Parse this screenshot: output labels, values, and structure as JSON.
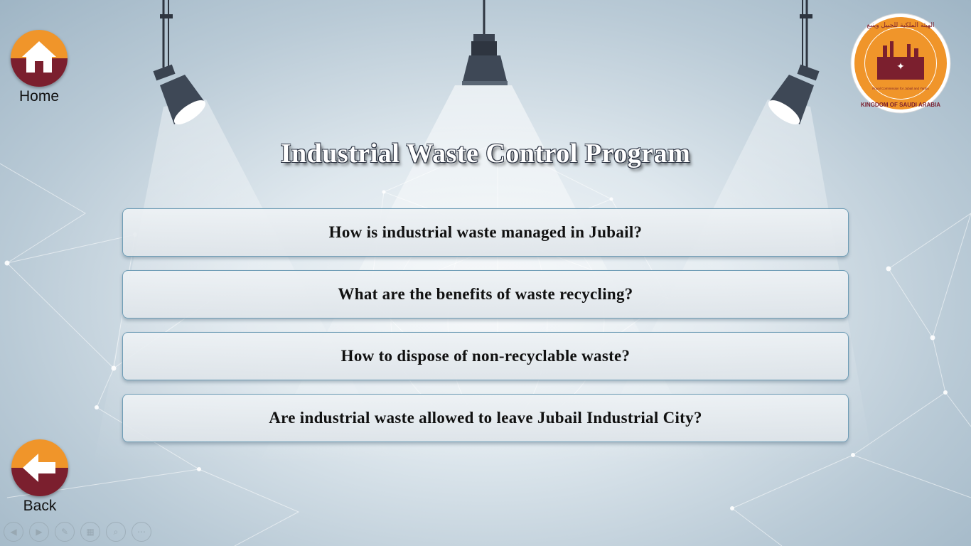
{
  "nav": {
    "home_label": "Home",
    "back_label": "Back",
    "home_icon": "home-icon",
    "back_icon": "arrow-left-icon"
  },
  "logo": {
    "arabic_text": "الهيئة الملكية للجبيل وينبع",
    "english_text": "KINGDOM OF SAUDI ARABIA",
    "sub_text": "Royal Commission for Jubail and Yanbu"
  },
  "title": "Industrial Waste Control Program",
  "questions": [
    "How is industrial waste managed in Jubail?",
    "What are the benefits of waste recycling?",
    "How to dispose of non-recyclable waste?",
    "Are industrial waste allowed to leave Jubail Industrial City?"
  ],
  "player_controls": [
    "previous-icon",
    "next-icon",
    "pen-icon",
    "slides-icon",
    "zoom-icon",
    "more-icon"
  ],
  "colors": {
    "button_top": "#f0952a",
    "button_bottom": "#7b1f2e",
    "question_border": "#6f9db6"
  }
}
